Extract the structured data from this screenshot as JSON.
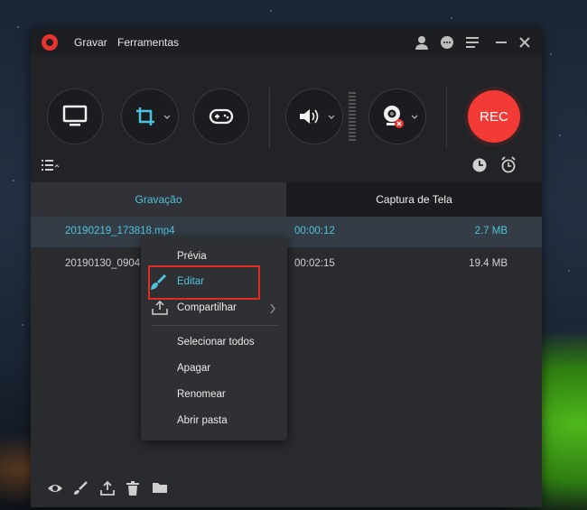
{
  "menu": {
    "record": "Gravar",
    "tools": "Ferramentas"
  },
  "title_icons": [
    "user-icon",
    "chat-icon",
    "menu-icon",
    "minimize-icon",
    "close-icon"
  ],
  "toolbar": {
    "rec_label": "REC",
    "buttons": [
      "screen-icon",
      "crop-region-icon",
      "gamepad-icon",
      "speaker-icon",
      "webcam-icon"
    ]
  },
  "tabs": {
    "recordings": "Gravação",
    "screenshots": "Captura de Tela"
  },
  "files": [
    {
      "name": "20190219_173818.mp4",
      "duration": "00:00:12",
      "size": "2.7 MB",
      "selected": true
    },
    {
      "name": "20190130_0904",
      "duration": "00:02:15",
      "size": "19.4 MB",
      "selected": false
    }
  ],
  "context_menu": {
    "preview": "Prévia",
    "edit": "Editar",
    "share": "Compartilhar",
    "select_all": "Selecionar todos",
    "delete": "Apagar",
    "rename": "Renomear",
    "open_folder": "Abrir pasta"
  },
  "bottom_icons": [
    "eye-icon",
    "brush-icon",
    "upload-icon",
    "trash-icon",
    "folder-icon"
  ],
  "colors": {
    "accent": "#4fc3dd",
    "rec": "#f23a36",
    "highlight": "#e12a23"
  }
}
